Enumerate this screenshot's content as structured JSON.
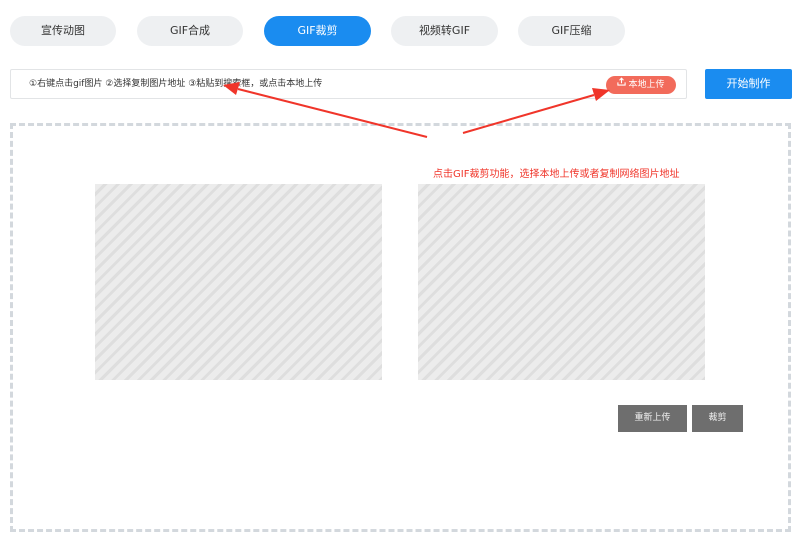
{
  "tabs": [
    {
      "label": "宣传动图",
      "active": false
    },
    {
      "label": "GIF合成",
      "active": false
    },
    {
      "label": "GIF裁剪",
      "active": true
    },
    {
      "label": "视频转GIF",
      "active": false
    },
    {
      "label": "GIF压缩",
      "active": false
    }
  ],
  "url_bar": {
    "hint": "①右键点击gif图片 ②选择复制图片地址 ③粘贴到搜索框，或点击本地上传",
    "upload_label": "本地上传",
    "upload_icon": "upload-icon"
  },
  "start_button": {
    "label": "开始制作"
  },
  "annotation": {
    "text": "点击GIF裁剪功能，选择本地上传或者复制网络图片地址",
    "color": "#f0352a"
  },
  "actions": {
    "reupload_label": "重新上传",
    "crop_label": "裁剪"
  },
  "colors": {
    "accent": "#1a8cf0",
    "upload": "#f26b5b",
    "arrow": "#f0352a",
    "action": "#6e6e6e"
  }
}
